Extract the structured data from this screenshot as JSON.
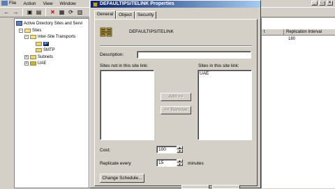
{
  "menu": {
    "file": "File",
    "action": "Action",
    "view": "View",
    "window": "Window"
  },
  "tree": {
    "root": "Active Directory Sites and Servi",
    "sites": "Sites",
    "inter_site": "Inter-Site Transports",
    "ip": "IP",
    "smtp": "SMTP",
    "subnets": "Subnets",
    "uae": "UAE"
  },
  "list": {
    "col_cost": "t",
    "col_interval": "Replication Interval",
    "row_cost": "",
    "row_interval": "180"
  },
  "dialog": {
    "title": "DEFAULTIPSITELINK Properties",
    "tabs": [
      "General",
      "Object",
      "Security"
    ],
    "site_link_name": "DEFAULTIPSITELINK",
    "description_label": "Description:",
    "description_value": "",
    "sites_not_label": "Sites not in this site link:",
    "sites_in_label": "Sites in this site link:",
    "sites_in_items": [
      "UAE"
    ],
    "add_button": "Add >>",
    "remove_button": "<< Remove",
    "cost_label": "Cost:",
    "cost_value": "100",
    "replicate_label": "Replicate every",
    "replicate_value": "15",
    "minutes_label": "minutes",
    "change_schedule_button": "Change Schedule..."
  },
  "colors": {
    "titlebar": "#0a246a",
    "face": "#d4d0c8"
  }
}
